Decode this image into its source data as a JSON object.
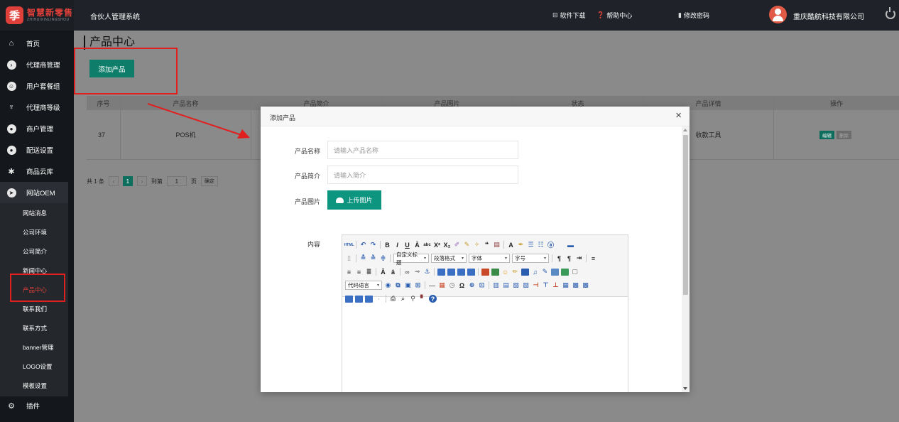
{
  "app": {
    "logo_mark": "季",
    "logo_title": "智慧新零售",
    "logo_sub": "ZHIHUIXINLINGSHOU",
    "system_title": "合伙人管理系统"
  },
  "topbar": {
    "download_label": "软件下载",
    "help_label": "帮助中心",
    "password_label": "修改密码",
    "company_name": "重庆酷航科技有限公司"
  },
  "sidebar": {
    "items": [
      {
        "label": "首页",
        "icon": "home-icon"
      },
      {
        "label": "代理商管理",
        "icon": "agent-icon"
      },
      {
        "label": "用户套餐组",
        "icon": "package-icon"
      },
      {
        "label": "代理商等级",
        "icon": "level-icon"
      },
      {
        "label": "商户管理",
        "icon": "merchant-icon"
      },
      {
        "label": "配送设置",
        "icon": "delivery-icon"
      },
      {
        "label": "商品云库",
        "icon": "cloud-store-icon"
      },
      {
        "label": "网站OEM",
        "icon": "oem-icon"
      },
      {
        "label": "插件",
        "icon": "plugin-icon"
      }
    ],
    "sub_items": [
      "网站消息",
      "公司环境",
      "公司简介",
      "新闻中心",
      "产品中心",
      "联系我们",
      "联系方式",
      "banner管理",
      "LOGO设置",
      "模板设置"
    ],
    "active_sub": "产品中心"
  },
  "main": {
    "page_title": "产品中心",
    "add_button": "添加产品",
    "table": {
      "headers": [
        "序号",
        "产品名称",
        "产品简介",
        "产品图片",
        "状态",
        "产品详情",
        "操作"
      ],
      "rows": [
        {
          "id": "37",
          "name": "POS机",
          "detail": "收款工具",
          "edit": "编辑",
          "delete": "删除"
        }
      ]
    },
    "pager": {
      "total": "共 1 条",
      "current": "1",
      "goto_label": "到第",
      "goto_value": "1",
      "page_unit": "页",
      "confirm": "确定"
    }
  },
  "modal": {
    "title": "添加产品",
    "close": "×",
    "fields": {
      "name_label": "产品名称",
      "name_placeholder": "请输入产品名称",
      "intro_label": "产品简介",
      "intro_placeholder": "请输入简介",
      "image_label": "产品图片",
      "upload_button": "上传图片",
      "content_label": "内容"
    },
    "editor": {
      "custom_title": "自定义标题",
      "paragraph": "段落格式",
      "font_family": "字体",
      "font_size": "字号",
      "code_lang": "代码语言"
    }
  },
  "colors": {
    "accent": "#0e7e6a",
    "danger": "#e01f1f",
    "topbar": "#1f2329",
    "sidebar": "#14171b"
  }
}
